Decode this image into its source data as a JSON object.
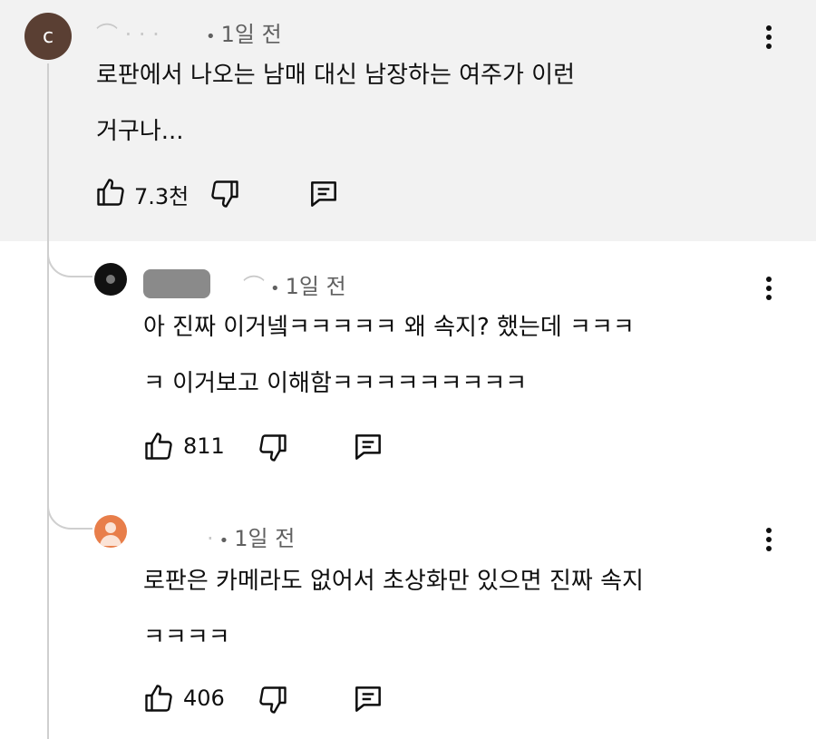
{
  "comments": [
    {
      "avatar_letter": "c",
      "avatar_color": "#5a3f33",
      "time": "1일 전",
      "lines": [
        "로판에서 나오는 남매 대신 남장하는 여주가 이런",
        "거구나..."
      ],
      "likes": "7.3천"
    },
    {
      "avatar_color": "#111111",
      "time": "1일 전",
      "lines": [
        "아 진짜 이거넼ㅋㅋㅋㅋㅋ 왜 속지? 했는데 ㅋㅋㅋ",
        "ㅋ 이거보고 이해함ㅋㅋㅋㅋㅋㅋㅋㅋㅋ"
      ],
      "likes": "811"
    },
    {
      "avatar_color": "#e87e4a",
      "time": "1일 전",
      "lines": [
        "로판은 카메라도 없어서 초상화만 있으면 진짜 속지",
        "ㅋㅋㅋㅋ"
      ],
      "likes": "406"
    }
  ],
  "icons": {
    "like": "thumbs-up-icon",
    "dislike": "thumbs-down-icon",
    "reply": "reply-comment-icon",
    "more": "more-vertical-icon",
    "default_avatar": "person-avatar-icon"
  },
  "colors": {
    "highlight_bg": "#f2f2f2",
    "thread_line": "#cfcfcf",
    "meta_text": "#606060"
  }
}
